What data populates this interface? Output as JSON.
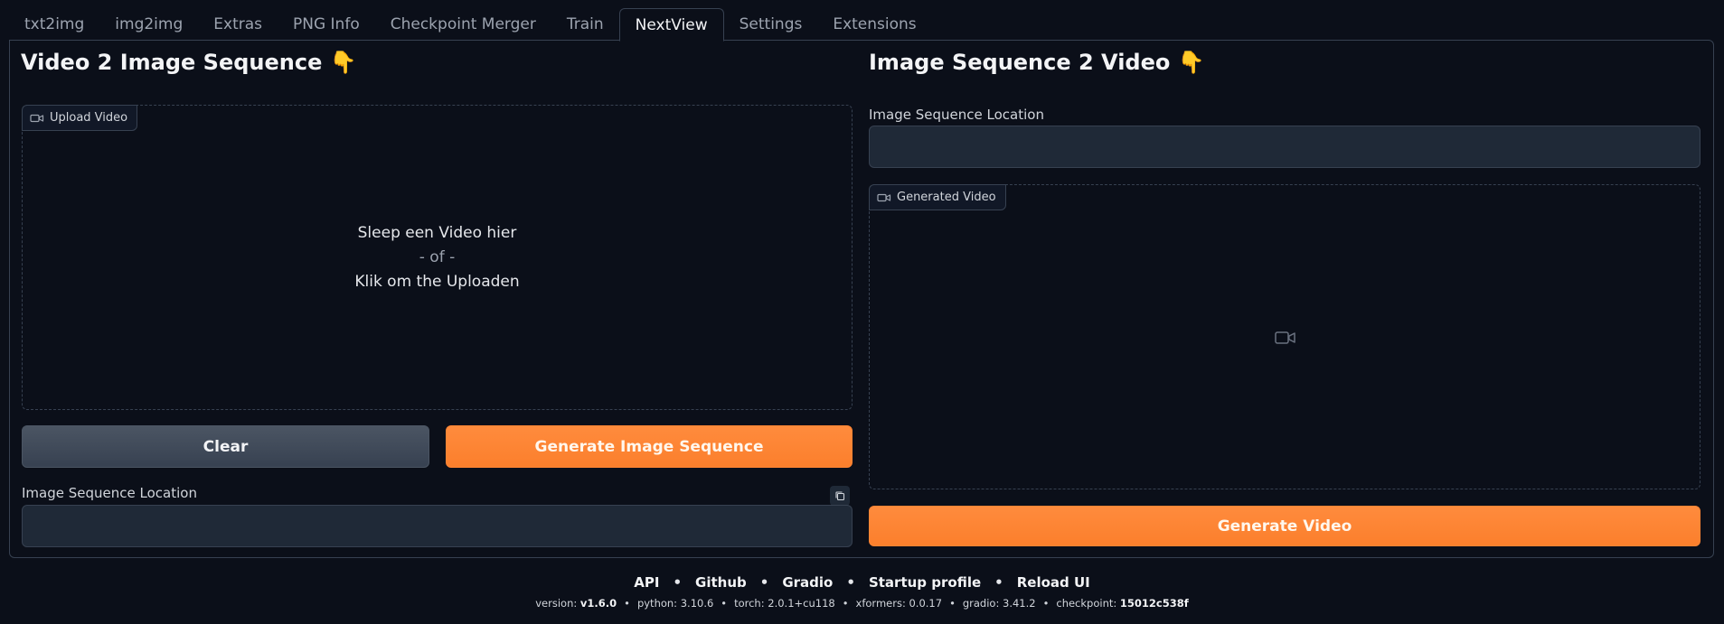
{
  "tabs": [
    "txt2img",
    "img2img",
    "Extras",
    "PNG Info",
    "Checkpoint Merger",
    "Train",
    "NextView",
    "Settings",
    "Extensions"
  ],
  "active_tab": "NextView",
  "left": {
    "title": "Video 2 Image Sequence 👇",
    "upload_label": "Upload Video",
    "drop_line1": "Sleep een Video hier",
    "drop_line2": "- of -",
    "drop_line3": "Klik om the Uploaden",
    "clear_label": "Clear",
    "generate_label": "Generate Image Sequence",
    "location_label": "Image Sequence Location",
    "location_value": ""
  },
  "right": {
    "title": "Image Sequence 2 Video 👇",
    "location_label": "Image Sequence Location",
    "location_value": "",
    "video_label": "Generated Video",
    "generate_label": "Generate Video"
  },
  "footer": {
    "links": [
      "API",
      "Github",
      "Gradio",
      "Startup profile",
      "Reload UI"
    ],
    "versions": [
      {
        "key": "version:",
        "value": "v1.6.0",
        "bold": true
      },
      {
        "key": "python:",
        "value": "3.10.6",
        "bold": false
      },
      {
        "key": "torch:",
        "value": "2.0.1+cu118",
        "bold": false
      },
      {
        "key": "xformers:",
        "value": "0.0.17",
        "bold": false
      },
      {
        "key": "gradio:",
        "value": "3.41.2",
        "bold": false
      },
      {
        "key": "checkpoint:",
        "value": "15012c538f",
        "bold": true
      }
    ]
  },
  "colors": {
    "background": "#0b0f19",
    "primary": "#ff8534",
    "border": "#374151"
  }
}
